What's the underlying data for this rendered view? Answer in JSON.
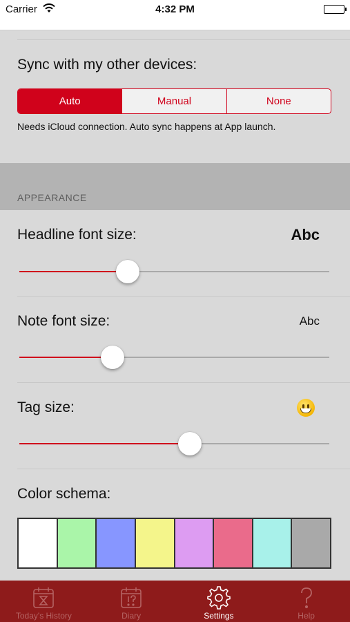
{
  "status_bar": {
    "carrier": "Carrier",
    "time": "4:32 PM"
  },
  "sync": {
    "label": "Sync with my other devices:",
    "options": [
      "Auto",
      "Manual",
      "None"
    ],
    "selected": "Auto",
    "note": "Needs iCloud connection. Auto sync happens at App launch."
  },
  "appearance": {
    "header": "APPEARANCE",
    "headline": {
      "label": "Headline font size:",
      "preview": "Abc",
      "level_percent": 35
    },
    "note": {
      "label": "Note font size:",
      "preview": "Abc",
      "level_percent": 30
    },
    "tag": {
      "label": "Tag size:",
      "preview_icon": "grinning-face-emoji",
      "level_percent": 55
    },
    "color_schema": {
      "label": "Color schema:",
      "swatches": [
        "#ffffff",
        "#aaf5a9",
        "#8796ff",
        "#f4f58b",
        "#dd9cf2",
        "#ea6b8b",
        "#a8f1ea",
        "#a9a9a9"
      ]
    }
  },
  "tab_bar": {
    "background": "#8e1b1b",
    "tabs": [
      {
        "label": "Today's History",
        "icon": "hourglass-calendar-icon"
      },
      {
        "label": "Diary",
        "icon": "diary-calendar-icon"
      },
      {
        "label": "Settings",
        "icon": "gear-icon",
        "active": true
      },
      {
        "label": "Help",
        "icon": "question-mark-icon"
      }
    ]
  },
  "colors": {
    "accent": "#d0021b",
    "background": "#d9d9d9",
    "group_header": "#b3b3b3"
  }
}
